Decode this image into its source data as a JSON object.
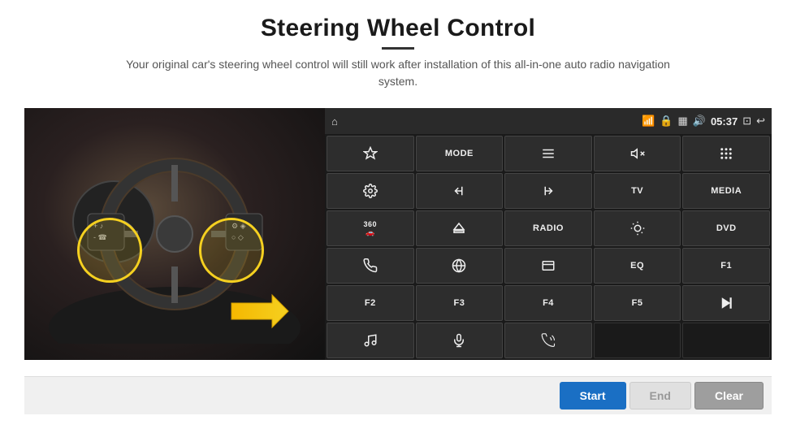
{
  "header": {
    "title": "Steering Wheel Control",
    "subtitle": "Your original car's steering wheel control will still work after installation of this all-in-one auto radio navigation system."
  },
  "status_bar": {
    "time": "05:37",
    "icons": [
      "wifi",
      "lock",
      "sim",
      "bluetooth",
      "screen",
      "back"
    ]
  },
  "control_buttons": [
    {
      "id": "b1",
      "label": "nav",
      "type": "icon"
    },
    {
      "id": "b2",
      "label": "MODE",
      "type": "text"
    },
    {
      "id": "b3",
      "label": "menu",
      "type": "icon"
    },
    {
      "id": "b4",
      "label": "vol-mute",
      "type": "icon"
    },
    {
      "id": "b5",
      "label": "apps",
      "type": "icon"
    },
    {
      "id": "b6",
      "label": "settings",
      "type": "icon"
    },
    {
      "id": "b7",
      "label": "prev",
      "type": "icon"
    },
    {
      "id": "b8",
      "label": "next",
      "type": "icon"
    },
    {
      "id": "b9",
      "label": "TV",
      "type": "text"
    },
    {
      "id": "b10",
      "label": "MEDIA",
      "type": "text"
    },
    {
      "id": "b11",
      "label": "360cam",
      "type": "icon"
    },
    {
      "id": "b12",
      "label": "eject",
      "type": "icon"
    },
    {
      "id": "b13",
      "label": "RADIO",
      "type": "text"
    },
    {
      "id": "b14",
      "label": "brightness",
      "type": "icon"
    },
    {
      "id": "b15",
      "label": "DVD",
      "type": "text"
    },
    {
      "id": "b16",
      "label": "phone",
      "type": "icon"
    },
    {
      "id": "b17",
      "label": "internet",
      "type": "icon"
    },
    {
      "id": "b18",
      "label": "window",
      "type": "icon"
    },
    {
      "id": "b19",
      "label": "EQ",
      "type": "text"
    },
    {
      "id": "b20",
      "label": "F1",
      "type": "text"
    },
    {
      "id": "b21",
      "label": "F2",
      "type": "text"
    },
    {
      "id": "b22",
      "label": "F3",
      "type": "text"
    },
    {
      "id": "b23",
      "label": "F4",
      "type": "text"
    },
    {
      "id": "b24",
      "label": "F5",
      "type": "text"
    },
    {
      "id": "b25",
      "label": "play-pause",
      "type": "icon"
    },
    {
      "id": "b26",
      "label": "music",
      "type": "icon"
    },
    {
      "id": "b27",
      "label": "mic",
      "type": "icon"
    },
    {
      "id": "b28",
      "label": "phone-vol",
      "type": "icon"
    },
    {
      "id": "b29",
      "label": "",
      "type": "empty"
    },
    {
      "id": "b30",
      "label": "",
      "type": "empty"
    }
  ],
  "bottom_buttons": {
    "start": "Start",
    "end": "End",
    "clear": "Clear"
  }
}
